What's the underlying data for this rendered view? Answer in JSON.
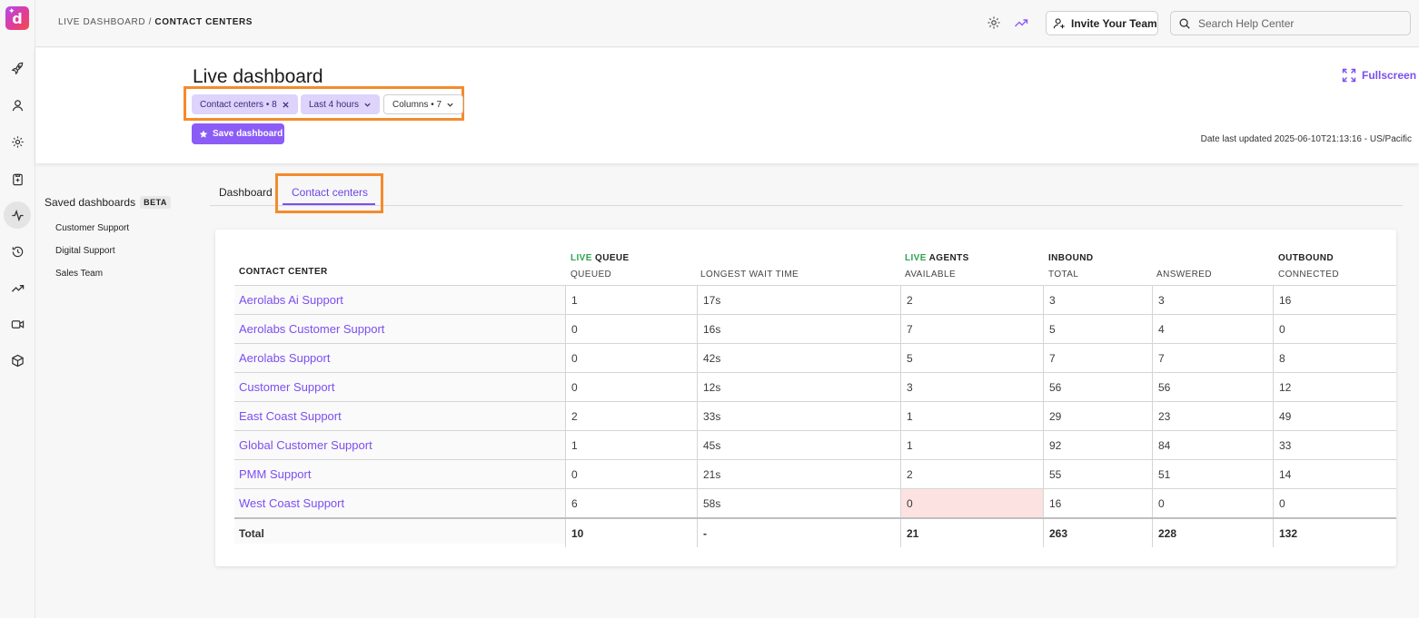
{
  "brand": {
    "logo_letter": "d",
    "accent": "#8b5cf6",
    "highlight": "#f58a2c"
  },
  "breadcrumb": {
    "parent": "LIVE DASHBOARD",
    "separator": "/",
    "current": "CONTACT CENTERS"
  },
  "topbar": {
    "invite_label": "Invite Your Team",
    "search_placeholder": "Search Help Center"
  },
  "header": {
    "title": "Live dashboard",
    "filters": {
      "contact_centers": "Contact centers • 8",
      "time_range": "Last 4 hours",
      "columns": "Columns • 7"
    },
    "save_label": "Save dashboard",
    "fullscreen_label": "Fullscreen",
    "last_updated": "Date last updated 2025-06-10T21:13:16 - US/Pacific"
  },
  "saved_dashboards": {
    "title": "Saved dashboards",
    "badge": "BETA",
    "items": [
      "Customer Support",
      "Digital Support",
      "Sales Team"
    ]
  },
  "tabs": [
    {
      "label": "Dashboard",
      "active": false
    },
    {
      "label": "Contact centers",
      "active": true
    }
  ],
  "table": {
    "groups": {
      "live_queue": {
        "live": "LIVE",
        "rest": "QUEUE"
      },
      "live_agents": {
        "live": "LIVE",
        "rest": "AGENTS"
      },
      "inbound": "INBOUND",
      "outbound": "OUTBOUND"
    },
    "columns": {
      "contact_center": "CONTACT CENTER",
      "queued": "QUEUED",
      "longest_wait": "LONGEST WAIT TIME",
      "available": "AVAILABLE",
      "total": "TOTAL",
      "answered": "ANSWERED",
      "connected": "CONNECTED"
    },
    "rows": [
      {
        "name": "Aerolabs Ai Support",
        "queued": "1",
        "wait": "17s",
        "available": "2",
        "total": "3",
        "answered": "3",
        "connected": "16"
      },
      {
        "name": "Aerolabs Customer Support",
        "queued": "0",
        "wait": "16s",
        "available": "7",
        "total": "5",
        "answered": "4",
        "connected": "0"
      },
      {
        "name": "Aerolabs Support",
        "queued": "0",
        "wait": "42s",
        "available": "5",
        "total": "7",
        "answered": "7",
        "connected": "8"
      },
      {
        "name": "Customer Support",
        "queued": "0",
        "wait": "12s",
        "available": "3",
        "total": "56",
        "answered": "56",
        "connected": "12"
      },
      {
        "name": "East Coast Support",
        "queued": "2",
        "wait": "33s",
        "available": "1",
        "total": "29",
        "answered": "23",
        "connected": "49"
      },
      {
        "name": "Global Customer Support",
        "queued": "1",
        "wait": "45s",
        "available": "1",
        "total": "92",
        "answered": "84",
        "connected": "33"
      },
      {
        "name": "PMM Support",
        "queued": "0",
        "wait": "21s",
        "available": "2",
        "total": "55",
        "answered": "51",
        "connected": "14"
      },
      {
        "name": "West Coast Support",
        "queued": "6",
        "wait": "58s",
        "available": "0",
        "total": "16",
        "answered": "0",
        "connected": "0"
      }
    ],
    "totals": {
      "name": "Total",
      "queued": "10",
      "wait": "-",
      "available": "21",
      "total": "263",
      "answered": "228",
      "connected": "132"
    }
  }
}
